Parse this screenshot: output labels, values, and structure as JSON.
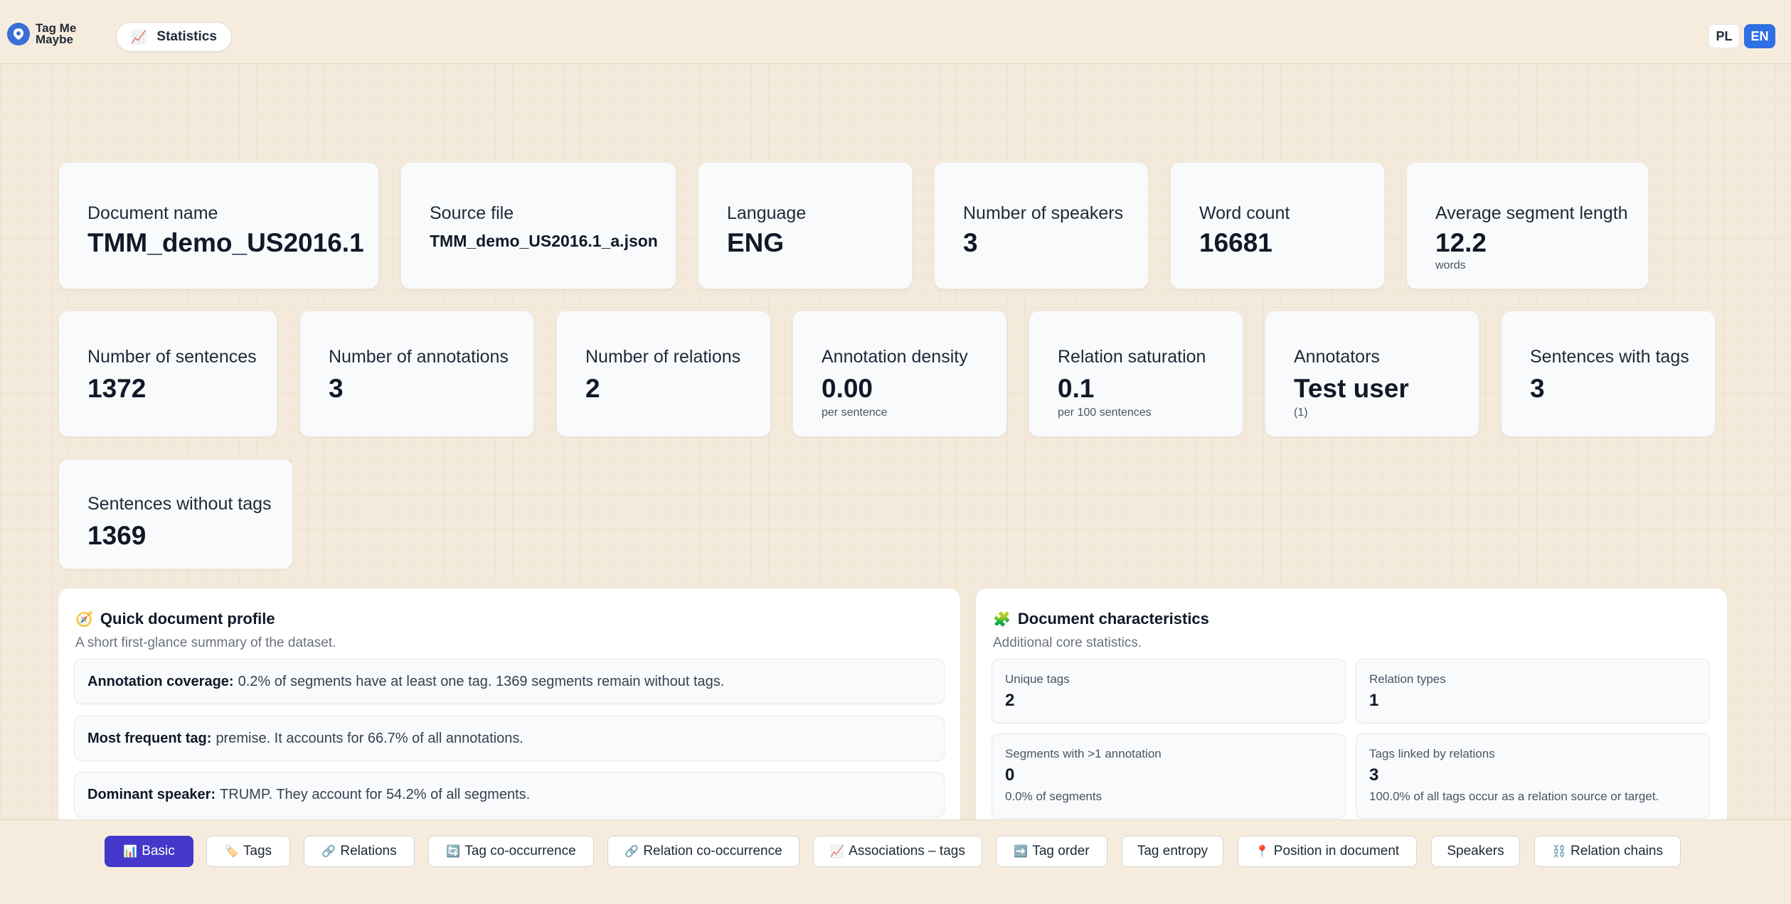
{
  "app": {
    "name": "Tag Me Maybe",
    "page_label": "Statistics",
    "page_icon": "chart-icon"
  },
  "languages": [
    {
      "label": "PL",
      "active": false
    },
    {
      "label": "EN",
      "active": true
    }
  ],
  "stats_row1": [
    {
      "label": "Document name",
      "value": "TMM_demo_US2016.1",
      "sub": ""
    },
    {
      "label": "Source file",
      "value": "TMM_demo_US2016.1_a.json",
      "sub": ""
    },
    {
      "label": "Language",
      "value": "ENG",
      "sub": ""
    },
    {
      "label": "Number of speakers",
      "value": "3",
      "sub": ""
    },
    {
      "label": "Word count",
      "value": "16681",
      "sub": ""
    },
    {
      "label": "Average segment length",
      "value": "12.2",
      "sub": "words"
    }
  ],
  "stats_row2": [
    {
      "label": "Number of sentences",
      "value": "1372",
      "sub": ""
    },
    {
      "label": "Number of annotations",
      "value": "3",
      "sub": ""
    },
    {
      "label": "Number of relations",
      "value": "2",
      "sub": ""
    },
    {
      "label": "Annotation density",
      "value": "0.00",
      "sub": "per sentence"
    },
    {
      "label": "Relation saturation",
      "value": "0.1",
      "sub": "per 100 sentences"
    },
    {
      "label": "Annotators",
      "value": "Test user",
      "sub": "(1)"
    },
    {
      "label": "Sentences with tags",
      "value": "3",
      "sub": ""
    }
  ],
  "stats_row3": [
    {
      "label": "Sentences without tags",
      "value": "1369",
      "sub": ""
    }
  ],
  "quick_profile": {
    "title": "Quick document profile",
    "subtitle": "A short first-glance summary of the dataset.",
    "rows": [
      {
        "key": "Annotation coverage:",
        "text": "0.2% of segments have at least one tag. 1369 segments remain without tags."
      },
      {
        "key": "Most frequent tag:",
        "text": "premise. It accounts for 66.7% of all annotations."
      },
      {
        "key": "Dominant speaker:",
        "text": "TRUMP. They account for 54.2% of all segments."
      }
    ]
  },
  "characteristics": {
    "title": "Document characteristics",
    "subtitle": "Additional core statistics.",
    "items": [
      {
        "label": "Unique tags",
        "value": "2",
        "sub": ""
      },
      {
        "label": "Relation types",
        "value": "1",
        "sub": ""
      },
      {
        "label": "Segments with >1 annotation",
        "value": "0",
        "sub": "0.0% of segments"
      },
      {
        "label": "Tags linked by relations",
        "value": "3",
        "sub": "100.0% of all tags occur as a relation source or target."
      }
    ]
  },
  "bottom_tabs": [
    {
      "label": "Basic",
      "icon": "📊",
      "active": true
    },
    {
      "label": "Tags",
      "icon": "🏷️",
      "active": false
    },
    {
      "label": "Relations",
      "icon": "🔗",
      "active": false
    },
    {
      "label": "Tag co-occurrence",
      "icon": "🔄",
      "active": false
    },
    {
      "label": "Relation co-occurrence",
      "icon": "🔗",
      "active": false
    },
    {
      "label": "Associations – tags",
      "icon": "📈",
      "active": false
    },
    {
      "label": "Tag order",
      "icon": "➡️",
      "active": false
    },
    {
      "label": "Tag entropy",
      "icon": "",
      "active": false
    },
    {
      "label": "Position in document",
      "icon": "📍",
      "active": false
    },
    {
      "label": "Speakers",
      "icon": "",
      "active": false
    },
    {
      "label": "Relation chains",
      "icon": "⛓️",
      "active": false
    }
  ]
}
